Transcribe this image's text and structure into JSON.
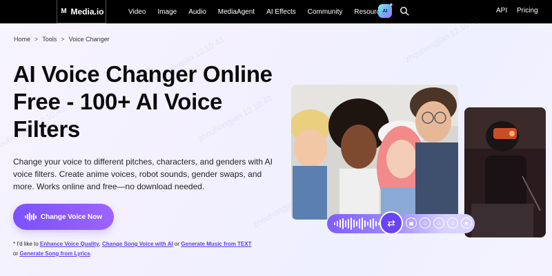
{
  "nav": {
    "logo_text": "Media.io",
    "logo_mark": "M",
    "links": [
      "Video",
      "Image",
      "Audio",
      "MediaAgent",
      "AI Effects",
      "Community",
      "Resources"
    ],
    "ai_badge": "AI",
    "api": "API",
    "pricing": "Pricing"
  },
  "breadcrumb": {
    "home": "Home",
    "tools": "Tools",
    "current": "Voice Changer",
    "separator": ">"
  },
  "hero": {
    "title": "AI Voice Changer Online Free - 100+ AI Voice Filters",
    "description": "Change your voice to different pitches, characters, and genders with AI voice filters. Create anime voices, robot sounds, gender swaps, and more. Works online and free—no download needed.",
    "cta_label": "Change Voice Now"
  },
  "footnote": {
    "prefix": "* I'd like to",
    "link1": "Enhance Voice Quality",
    "sep1": ",",
    "link2": "Change Song Voice with AI",
    "or1": "or",
    "link3": "Generate Music from TEXT",
    "or2": "or",
    "link4": "Generate Song from Lyrics",
    "suffix": "."
  },
  "watermark": "zhouhongjian 12:10:43",
  "colors": {
    "accent": "#7a52ff",
    "link": "#5b3df5",
    "nav_bg": "#000000"
  },
  "icons": [
    "search-icon",
    "sound-wave-icon",
    "swap-arrows-icon",
    "robot-icon",
    "baby-icon",
    "girl-icon",
    "boy-icon",
    "man-icon"
  ]
}
